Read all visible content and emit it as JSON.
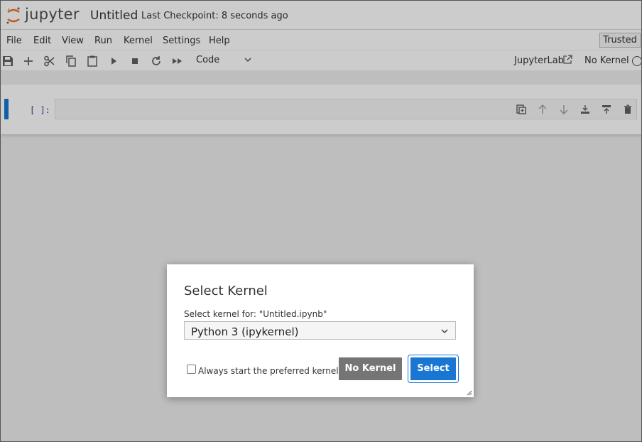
{
  "app": {
    "logo_text": "jupyter",
    "notebook_title": "Untitled",
    "checkpoint": "Last Checkpoint: 8 seconds ago"
  },
  "menubar": {
    "items": [
      "File",
      "Edit",
      "View",
      "Run",
      "Kernel",
      "Settings",
      "Help"
    ],
    "trusted_label": "Trusted"
  },
  "toolbar": {
    "icons": [
      "save-icon",
      "add-icon",
      "cut-icon",
      "copy-icon",
      "paste-icon",
      "run-icon",
      "stop-icon",
      "restart-icon",
      "fast-forward-icon"
    ],
    "cell_type": "Code",
    "jupyterlab_label": "JupyterLab",
    "kernel_label": "No Kernel"
  },
  "cell": {
    "prompt": "[ ]:",
    "tools": [
      "duplicate-icon",
      "move-up-icon",
      "move-down-icon",
      "insert-above-icon",
      "insert-below-icon",
      "delete-icon"
    ]
  },
  "dialog": {
    "title": "Select Kernel",
    "label": "Select kernel for: \"Untitled.ipynb\"",
    "selected_kernel": "Python 3 (ipykernel)",
    "checkbox_label": "Always start the preferred kernel",
    "checkbox_checked": false,
    "no_kernel_label": "No Kernel",
    "select_label": "Select"
  },
  "colors": {
    "accent": "#1976d2",
    "logo_orange": "#f37726",
    "secondary_button": "#757575"
  }
}
